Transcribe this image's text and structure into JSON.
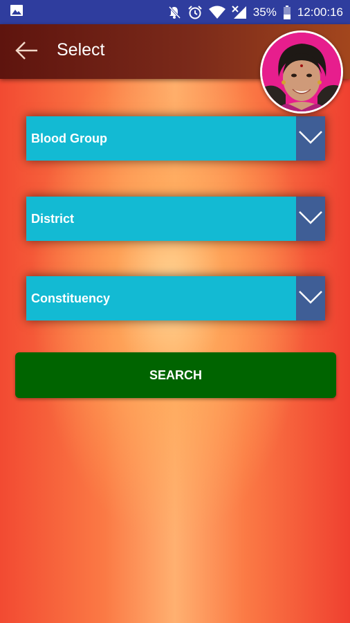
{
  "status_bar": {
    "battery": "35%",
    "time": "12:00:16",
    "left_icon": "image-notification-icon",
    "right_icons": [
      "mute-icon",
      "alarm-icon",
      "wifi-icon",
      "signal-icon",
      "battery-icon"
    ]
  },
  "toolbar": {
    "title": "Select",
    "back_icon": "arrow-left-icon"
  },
  "form": {
    "blood_group": {
      "label": "Blood Group"
    },
    "district": {
      "label": "District"
    },
    "constituency": {
      "label": "Constituency"
    },
    "dropdown_icon": "chevron-down-icon",
    "search_label": "SEARCH"
  },
  "colors": {
    "status_bar": "#2f3d9e",
    "dropdown_field": "#13bad3",
    "dropdown_arrow_box": "#3f5e96",
    "search_button": "#006400",
    "background_center": "#ffb070",
    "background_edge": "#f24a32"
  }
}
